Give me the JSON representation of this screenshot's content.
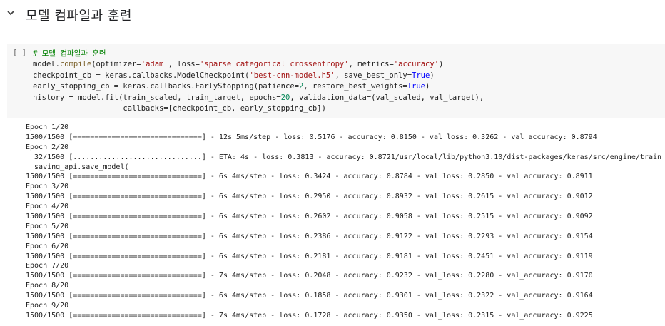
{
  "section": {
    "title": "모델 컴파일과 훈련",
    "chevron_icon": "chevron-down-icon"
  },
  "cell": {
    "run_marker": "[ ]",
    "code": {
      "comment": "# 모델 컴파일과 훈련",
      "l2_a": "model.",
      "l2_fn": "compile",
      "l2_b": "(optimizer=",
      "l2_s1": "'adam'",
      "l2_c": ", loss=",
      "l2_s2": "'sparse_categorical_crossentropy'",
      "l2_d": ", metrics=",
      "l2_s3": "'accuracy'",
      "l2_e": ")",
      "l3_a": "checkpoint_cb = keras.callbacks.ModelCheckpoint(",
      "l3_s": "'best-cnn-model.h5'",
      "l3_b": ", save_best_only=",
      "l3_k": "True",
      "l3_c": ")",
      "l4_a": "early_stopping_cb = keras.callbacks.EarlyStopping(patience=",
      "l4_n": "2",
      "l4_b": ", restore_best_weights=",
      "l4_k": "True",
      "l4_c": ")",
      "l5_a": "history = model.fit(train_scaled, train_target, epochs=",
      "l5_n": "20",
      "l5_b": ", validation_data=(val_scaled, val_target),",
      "l6": "                    callbacks=[checkpoint_cb, early_stopping_cb])"
    }
  },
  "output_lines": [
    "Epoch 1/20",
    "1500/1500 [==============================] - 12s 5ms/step - loss: 0.5176 - accuracy: 0.8150 - val_loss: 0.3262 - val_accuracy: 0.8794",
    "Epoch 2/20",
    "  32/1500 [..............................] - ETA: 4s - loss: 0.3813 - accuracy: 0.8721/usr/local/lib/python3.10/dist-packages/keras/src/engine/train",
    "  saving_api.save_model(",
    "1500/1500 [==============================] - 6s 4ms/step - loss: 0.3424 - accuracy: 0.8784 - val_loss: 0.2850 - val_accuracy: 0.8911",
    "Epoch 3/20",
    "1500/1500 [==============================] - 6s 4ms/step - loss: 0.2950 - accuracy: 0.8932 - val_loss: 0.2615 - val_accuracy: 0.9012",
    "Epoch 4/20",
    "1500/1500 [==============================] - 6s 4ms/step - loss: 0.2602 - accuracy: 0.9058 - val_loss: 0.2515 - val_accuracy: 0.9092",
    "Epoch 5/20",
    "1500/1500 [==============================] - 6s 4ms/step - loss: 0.2386 - accuracy: 0.9122 - val_loss: 0.2293 - val_accuracy: 0.9154",
    "Epoch 6/20",
    "1500/1500 [==============================] - 6s 4ms/step - loss: 0.2181 - accuracy: 0.9181 - val_loss: 0.2451 - val_accuracy: 0.9119",
    "Epoch 7/20",
    "1500/1500 [==============================] - 7s 4ms/step - loss: 0.2048 - accuracy: 0.9232 - val_loss: 0.2280 - val_accuracy: 0.9170",
    "Epoch 8/20",
    "1500/1500 [==============================] - 6s 4ms/step - loss: 0.1858 - accuracy: 0.9301 - val_loss: 0.2322 - val_accuracy: 0.9164",
    "Epoch 9/20",
    "1500/1500 [==============================] - 7s 4ms/step - loss: 0.1728 - accuracy: 0.9350 - val_loss: 0.2315 - val_accuracy: 0.9225"
  ]
}
